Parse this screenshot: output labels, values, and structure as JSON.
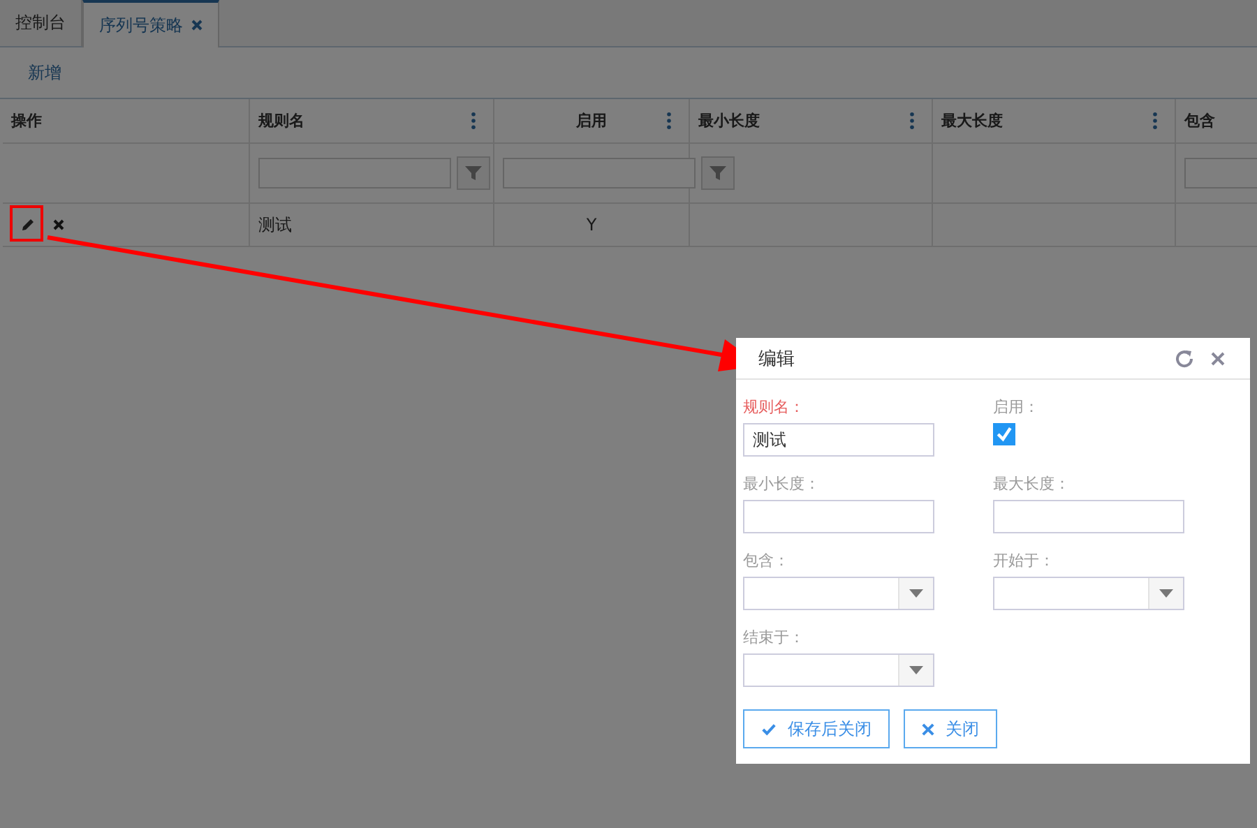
{
  "tabs": [
    {
      "label": "控制台",
      "selected": false,
      "closable": false
    },
    {
      "label": "序列号策略",
      "selected": true,
      "closable": true
    }
  ],
  "toolbar": {
    "add_button": "新增"
  },
  "table": {
    "columns": [
      {
        "label": "操作",
        "has_menu": false,
        "has_filter": false
      },
      {
        "label": "规则名",
        "has_menu": true,
        "has_filter": true
      },
      {
        "label": "启用",
        "has_menu": true,
        "has_filter": true
      },
      {
        "label": "最小长度",
        "has_menu": true,
        "has_filter": false
      },
      {
        "label": "最大长度",
        "has_menu": true,
        "has_filter": false
      },
      {
        "label": "包含",
        "has_menu": false,
        "has_filter": true
      }
    ],
    "rows": [
      {
        "cells": [
          "",
          "测试",
          "Y",
          "",
          "",
          ""
        ]
      }
    ]
  },
  "dialog": {
    "title": "编辑",
    "fields": [
      {
        "label": "规则名：",
        "kind": "text",
        "value": "测试",
        "required": true
      },
      {
        "label": "启用：",
        "kind": "checkbox",
        "checked": true,
        "required": false
      },
      {
        "label": "最小长度：",
        "kind": "text",
        "required": false
      },
      {
        "label": "最大长度：",
        "kind": "text",
        "required": false
      },
      {
        "label": "包含：",
        "kind": "select",
        "required": false
      },
      {
        "label": "开始于：",
        "kind": "select",
        "required": false
      },
      {
        "label": "结束于：",
        "kind": "select",
        "required": false
      }
    ],
    "buttons": [
      {
        "label": "保存后关闭",
        "kind": "save"
      },
      {
        "label": "关闭",
        "kind": "close"
      }
    ]
  }
}
